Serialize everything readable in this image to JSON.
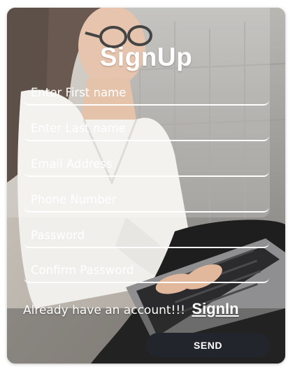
{
  "form": {
    "title": "SignUp",
    "fields": [
      {
        "name": "first-name",
        "placeholder": "Enter First name",
        "value": ""
      },
      {
        "name": "last-name",
        "placeholder": "Enter Last name",
        "value": ""
      },
      {
        "name": "email",
        "placeholder": "Email Address",
        "value": ""
      },
      {
        "name": "phone",
        "placeholder": "Phone Number",
        "value": ""
      },
      {
        "name": "password",
        "placeholder": "Password",
        "value": ""
      },
      {
        "name": "confirm-password",
        "placeholder": "Confirm Password",
        "value": ""
      }
    ],
    "signin_prompt": "Already have an account!!!",
    "signin_link": "SignIn",
    "send_label": "SEND"
  },
  "colors": {
    "text": "#ffffff",
    "button_bg": "#22252b",
    "button_text": "#ffffff"
  }
}
